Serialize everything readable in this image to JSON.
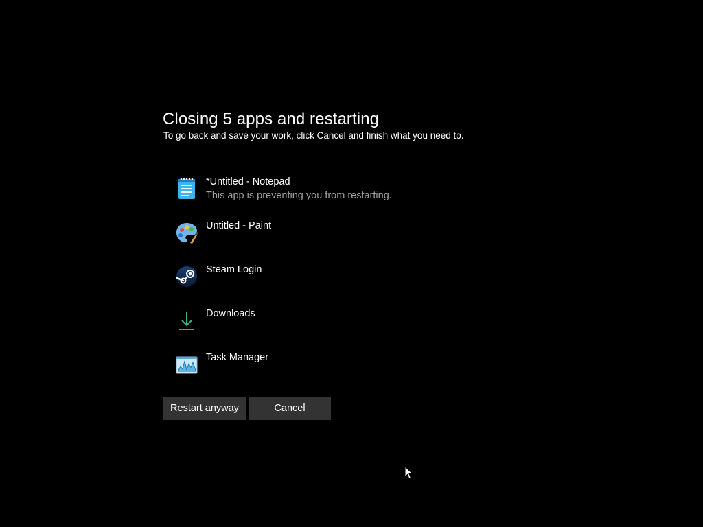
{
  "dialog": {
    "title": "Closing 5 apps and restarting",
    "subtitle": "To go back and save your work, click Cancel and finish what you need to."
  },
  "apps": [
    {
      "name": "*Untitled - Notepad",
      "status": "This app is preventing you from restarting.",
      "icon": "notepad-icon"
    },
    {
      "name": "Untitled - Paint",
      "status": "",
      "icon": "paint-icon"
    },
    {
      "name": "Steam Login",
      "status": "",
      "icon": "steam-icon"
    },
    {
      "name": "Downloads",
      "status": "",
      "icon": "download-icon"
    },
    {
      "name": "Task Manager",
      "status": "",
      "icon": "task-manager-icon"
    }
  ],
  "buttons": {
    "restart_label": "Restart anyway",
    "cancel_label": "Cancel"
  },
  "colors": {
    "background": "#000000",
    "button_bg": "#333333",
    "status_text": "#a0a0a0",
    "text": "#ffffff"
  }
}
